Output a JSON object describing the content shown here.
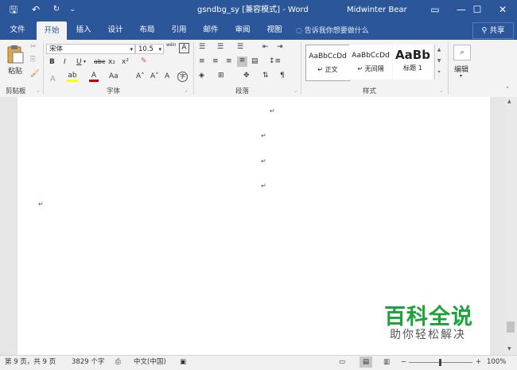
{
  "titlebar": {
    "title": "gsndbg_sy [兼容模式]  -  Word",
    "user": "Midwinter Bear",
    "quick": {
      "save_icon": "save-icon",
      "undo_icon": "undo-icon",
      "redo_icon": "redo-icon",
      "more_icon": "customize-icon"
    },
    "window_buttons": {
      "ribbon_options": "▭",
      "minimize": "—",
      "maximize": "☐",
      "close": "✕"
    },
    "quick_glyphs": {
      "save": "🖫",
      "undo": "↶",
      "redo": "↻",
      "more": "⌄"
    }
  },
  "tabs": [
    "文件",
    "开始",
    "插入",
    "设计",
    "布局",
    "引用",
    "邮件",
    "审阅",
    "视图"
  ],
  "tell_me": "告诉我你想要做什么",
  "share": "共享",
  "clipboard": {
    "label": "剪贴板",
    "paste": "粘贴"
  },
  "font": {
    "label": "字体",
    "name": "宋体",
    "size": "10.5",
    "bold": "B",
    "italic": "I",
    "underline": "U",
    "strike": "abc",
    "sub": "x₂",
    "sup": "x²",
    "grow": "A˄",
    "shrink": "A˅",
    "case": "Aa",
    "phonetic": "wén",
    "border_char": "A",
    "clear": "A"
  },
  "paragraph": {
    "label": "段落"
  },
  "styles": {
    "label": "样式",
    "items": [
      {
        "preview": "AaBbCcDd",
        "name": "↵ 正文"
      },
      {
        "preview": "AaBbCcDd",
        "name": "↵ 无间隔"
      },
      {
        "preview": "AaBb",
        "name": "标题 1"
      }
    ]
  },
  "editing": {
    "label": "编辑"
  },
  "document": {
    "paragraph_mark": "↵"
  },
  "status": {
    "page": "第 9 页，共 9 页",
    "words": "3829 个字",
    "lang": "中文(中国)",
    "zoom": "100%",
    "minus": "−",
    "plus": "+"
  },
  "watermark": {
    "main": "百科全说",
    "sub": "助你轻松解决"
  },
  "colors": {
    "accent": "#2b579a",
    "ribbon": "#f3f3f3",
    "highlight": "#ffff00",
    "font_color": "#c00000",
    "watermark": "#1aa33a"
  }
}
